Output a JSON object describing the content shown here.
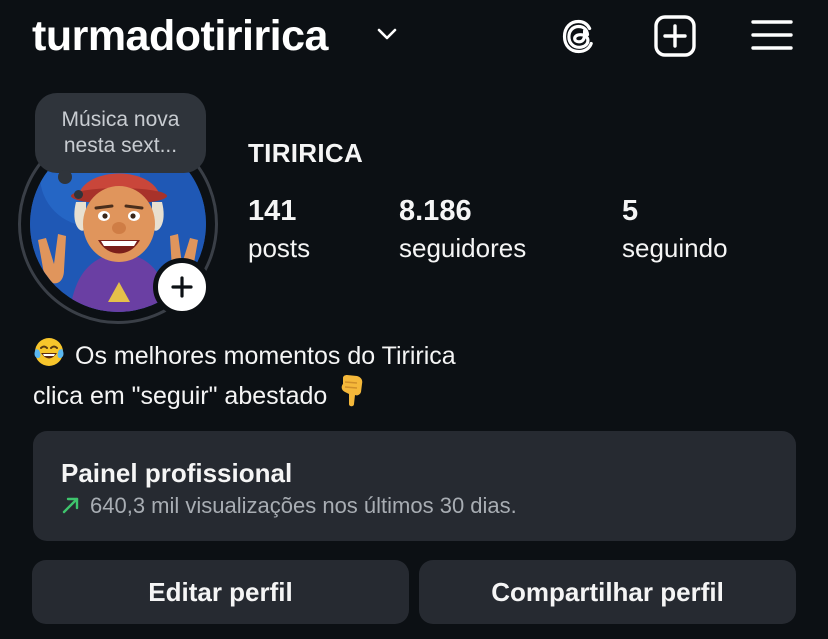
{
  "header": {
    "username": "turmadotiririca",
    "icons": [
      "chevron-down-icon",
      "threads-icon",
      "create-post-icon",
      "menu-icon"
    ]
  },
  "note": {
    "text_line1": "Música nova",
    "text_line2": "nesta sext..."
  },
  "profile": {
    "display_name": "TIRIRICA",
    "stats": {
      "posts": {
        "value": "141",
        "label": "posts"
      },
      "followers": {
        "value": "8.186",
        "label": "seguidores"
      },
      "following": {
        "value": "5",
        "label": "seguindo"
      }
    },
    "bio": {
      "line1_emoji": "face-with-tears-of-joy",
      "line1": "Os melhores momentos do Tiririca",
      "line2": "clica em \"seguir\" abestado",
      "line2_emoji": "backhand-index-pointing-down"
    }
  },
  "dashboard": {
    "title": "Painel profissional",
    "subtitle": "640,3 mil visualizações nos últimos 30 dias.",
    "trend_color": "#3ec46d"
  },
  "actions": {
    "edit_label": "Editar perfil",
    "share_label": "Compartilhar perfil"
  },
  "colors": {
    "background": "#0c1014",
    "surface": "#262a31",
    "text": "#f5f5f5",
    "muted": "#a8adb3"
  }
}
